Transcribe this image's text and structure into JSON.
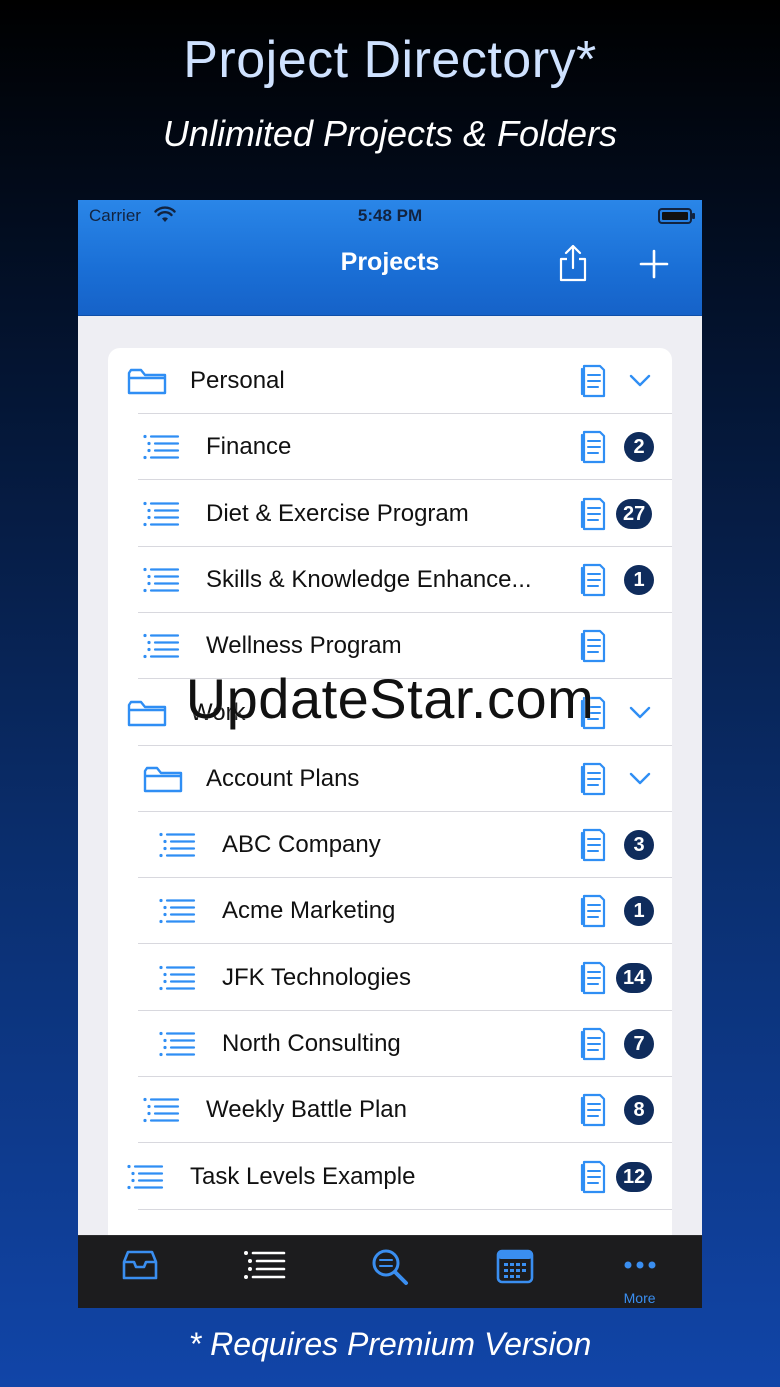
{
  "promo": {
    "title": "Project Directory*",
    "subtitle": "Unlimited Projects & Folders",
    "footer": "* Requires Premium Version"
  },
  "status_bar": {
    "carrier": "Carrier",
    "time": "5:48 PM",
    "icons": [
      "wifi-icon",
      "battery-icon"
    ]
  },
  "navbar": {
    "title": "Projects",
    "buttons": [
      "share-icon",
      "plus-icon"
    ]
  },
  "accent_color": "#1a6fd6",
  "badge_color": "#0f2c5c",
  "rows": [
    {
      "label": "Personal",
      "type": "folder",
      "level": 0,
      "expanded": true
    },
    {
      "label": "Finance",
      "type": "list",
      "level": 1,
      "count": "2"
    },
    {
      "label": "Diet & Exercise Program",
      "type": "list",
      "level": 1,
      "count": "27"
    },
    {
      "label": "Skills & Knowledge Enhance...",
      "type": "list",
      "level": 1,
      "count": "1"
    },
    {
      "label": "Wellness Program",
      "type": "list",
      "level": 1
    },
    {
      "label": "Work",
      "type": "folder",
      "level": 0,
      "expanded": true
    },
    {
      "label": "Account Plans",
      "type": "folder",
      "level": 1,
      "expanded": true
    },
    {
      "label": "ABC Company",
      "type": "list",
      "level": 2,
      "count": "3"
    },
    {
      "label": "Acme Marketing",
      "type": "list",
      "level": 2,
      "count": "1"
    },
    {
      "label": "JFK Technologies",
      "type": "list",
      "level": 2,
      "count": "14"
    },
    {
      "label": "North Consulting",
      "type": "list",
      "level": 2,
      "count": "7"
    },
    {
      "label": "Weekly Battle Plan",
      "type": "list",
      "level": 1,
      "count": "8"
    },
    {
      "label": "Task Levels Example",
      "type": "list",
      "level": 0,
      "count": "12"
    }
  ],
  "tabbar": {
    "tabs": [
      {
        "icon": "inbox-icon"
      },
      {
        "icon": "list-icon"
      },
      {
        "icon": "search-icon"
      },
      {
        "icon": "calendar-icon"
      },
      {
        "icon": "more-icon",
        "label": "More"
      }
    ]
  },
  "watermark": "UpdateStar.com"
}
